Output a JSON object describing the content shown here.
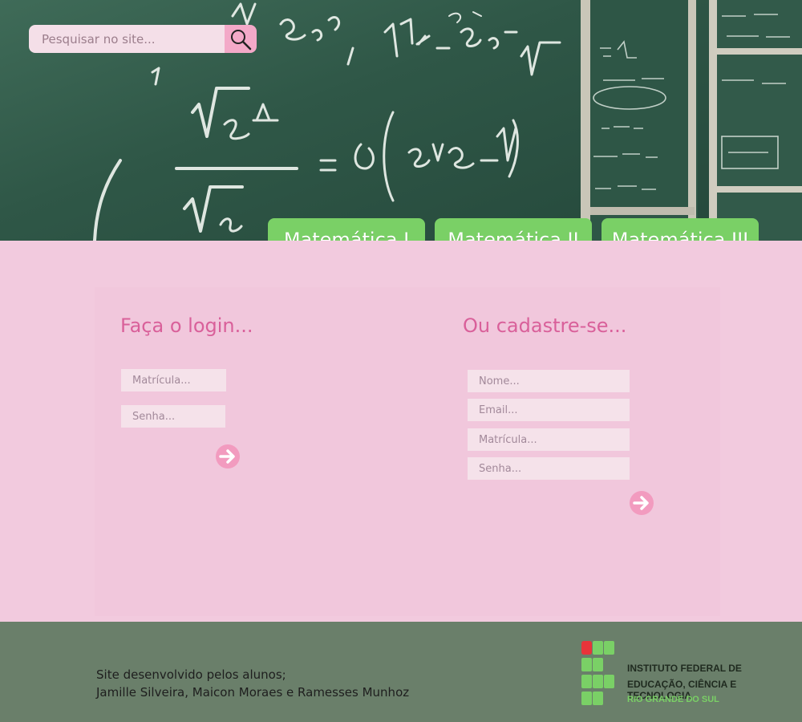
{
  "search": {
    "placeholder": "Pesquisar no site...",
    "icon": "search-icon"
  },
  "tabs": [
    {
      "label": "Matemática I"
    },
    {
      "label": "Matemática II"
    },
    {
      "label": "Matemática III"
    }
  ],
  "login": {
    "title": "Faça o login...",
    "fields": [
      {
        "placeholder": "Matrícula..."
      },
      {
        "placeholder": "Senha..."
      }
    ],
    "submit_icon": "arrow-right-icon"
  },
  "register": {
    "title": "Ou cadastre-se...",
    "fields": [
      {
        "placeholder": "Nome..."
      },
      {
        "placeholder": "Email..."
      },
      {
        "placeholder": "Matrícula..."
      },
      {
        "placeholder": "Senha..."
      }
    ],
    "submit_icon": "arrow-right-icon"
  },
  "footer": {
    "credit_line_1": "Site desenvolvido pelos alunos;",
    "credit_line_2": "Jamille Silveira, Maicon Moraes e Ramesses Munhoz",
    "logo": {
      "line_1": "INSTITUTO FEDERAL DE",
      "line_2": "EDUCAÇÃO, CIÊNCIA E TECNOLOGIA",
      "line_3": "RIO GRANDE DO SUL"
    }
  },
  "colors": {
    "accent_pink": "#d9609a",
    "tab_green": "#7ad066",
    "page_pink": "#f2cade",
    "footer_green": "#6a7f6a",
    "logo_red": "#e8343a"
  }
}
